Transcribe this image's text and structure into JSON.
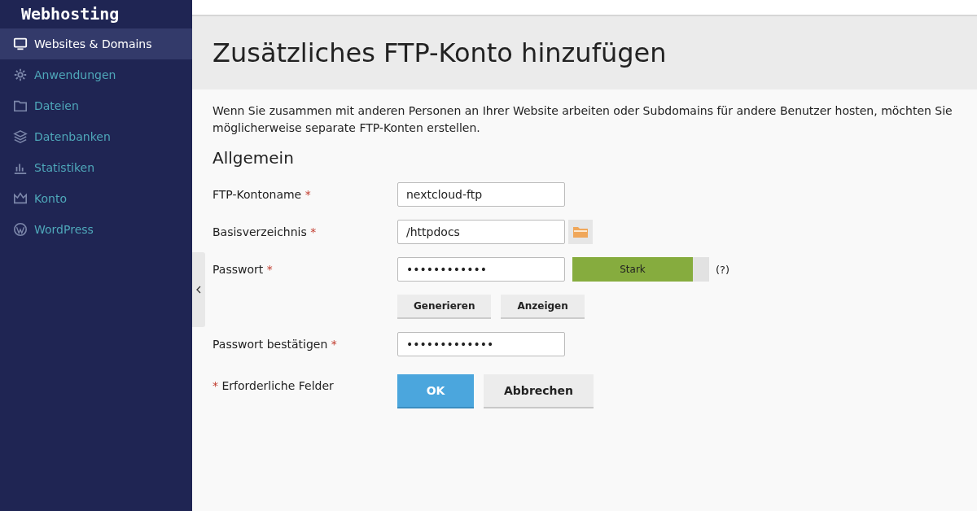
{
  "sidebar": {
    "logo": "Webhosting",
    "items": [
      {
        "label": "Websites & Domains",
        "selected": true
      },
      {
        "label": "Anwendungen",
        "selected": false
      },
      {
        "label": "Dateien",
        "selected": false
      },
      {
        "label": "Datenbanken",
        "selected": false
      },
      {
        "label": "Statistiken",
        "selected": false
      },
      {
        "label": "Konto",
        "selected": false
      },
      {
        "label": "WordPress",
        "selected": false
      }
    ]
  },
  "page": {
    "title": "Zusätzliches FTP-Konto hinzufügen",
    "description": "Wenn Sie zusammen mit anderen Personen an Ihrer Website arbeiten oder Subdomains für andere Benutzer hosten, möchten Sie möglicherweise separate FTP-Konten erstellen.",
    "section": "Allgemein"
  },
  "form": {
    "fields": [
      {
        "kind": "text",
        "label": "FTP-Kontoname",
        "required_mark": "*",
        "value": "nextcloud-ftp"
      },
      {
        "kind": "browse",
        "label": "Basisverzeichnis",
        "required_mark": "*",
        "value": "/httpdocs"
      },
      {
        "kind": "password",
        "label": "Passwort",
        "required_mark": "*",
        "value": "••••••••••••",
        "strength": {
          "label": "Stark",
          "level": 0.88
        },
        "help": "(?)",
        "buttons": [
          "Generieren",
          "Anzeigen"
        ]
      },
      {
        "kind": "text",
        "label": "Passwort bestätigen",
        "required_mark": "*",
        "value": "•••••••••••••"
      }
    ],
    "required_note": {
      "mark": "*",
      "text": "Erforderliche Felder"
    },
    "ok_button": "OK",
    "cancel_button": "Abbrechen"
  }
}
